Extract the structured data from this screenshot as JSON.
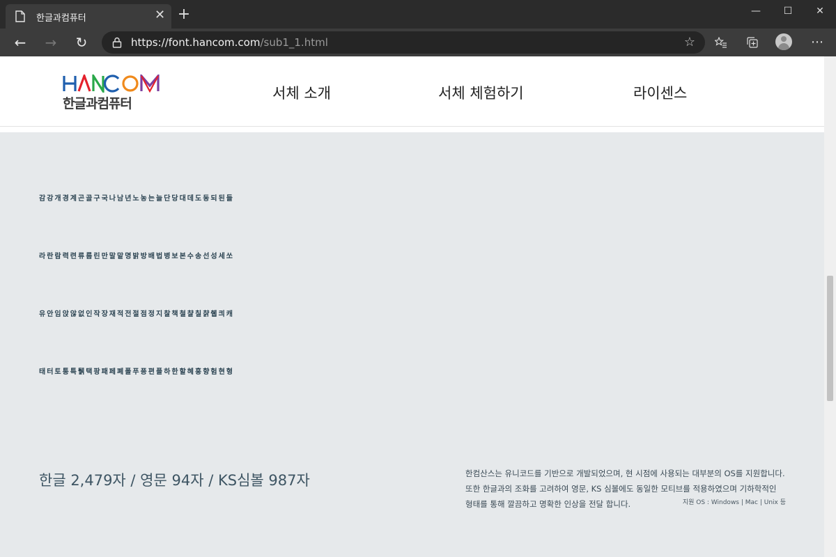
{
  "browser": {
    "tab_title": "한글과컴퓨터",
    "url_prefix": "https://",
    "url_host": "font.hancom.com",
    "url_path": "/sub1_1.html",
    "close_tab_glyph": "✕",
    "new_tab_glyph": "+",
    "minimize_glyph": "—",
    "maximize_glyph": "☐",
    "close_window_glyph": "✕",
    "back_glyph": "←",
    "forward_glyph": "→",
    "refresh_glyph": "↻",
    "favorite_glyph": "☆",
    "more_glyph": "⋯"
  },
  "header": {
    "logo_text": "HANCOM",
    "logo_subtitle": "한글과컴퓨터",
    "logo_colors": [
      "#1f5fae",
      "#e4212c",
      "#2aa84a",
      "#1f5fae",
      "#f08a1c",
      "#7b3fa0"
    ],
    "nav": [
      {
        "label": "서체 소개"
      },
      {
        "label": "서체 체험하기"
      },
      {
        "label": "라이센스"
      }
    ]
  },
  "main": {
    "sample_lines": [
      "감강개경계곤골구국나남년노농는늘단당대데도동되된들",
      "라란람력련류름린만말맡명밝방배법병보본수송선성세쏘",
      "유안임앉않없인작장재적전절점정지찰책철챨칠챩췝킈캐",
      "태터토통특퉭택팡패페폐폴푸픙편플하한할혜홍향험현형"
    ],
    "counts": "한글 2,479자 / 영문 94자 / KS심볼 987자",
    "description": [
      "한컴산스는 유니코드를 기반으로 개발되었으며, 현 시점에 사용되는 대부분의 OS를 지원합니다.",
      "또한 한글과의 조화를 고려하여 영문, KS 심볼에도 동일한 모티브를 적용하였으며 기하학적인",
      "형태를 통해 깔끔하고 명확한 인상을 전달 합니다."
    ],
    "support": "지원 OS : Windows | Mac | Unix 등"
  },
  "colors": {
    "content_bg": "#e6e9eb",
    "sample_text": "#2c4452"
  }
}
